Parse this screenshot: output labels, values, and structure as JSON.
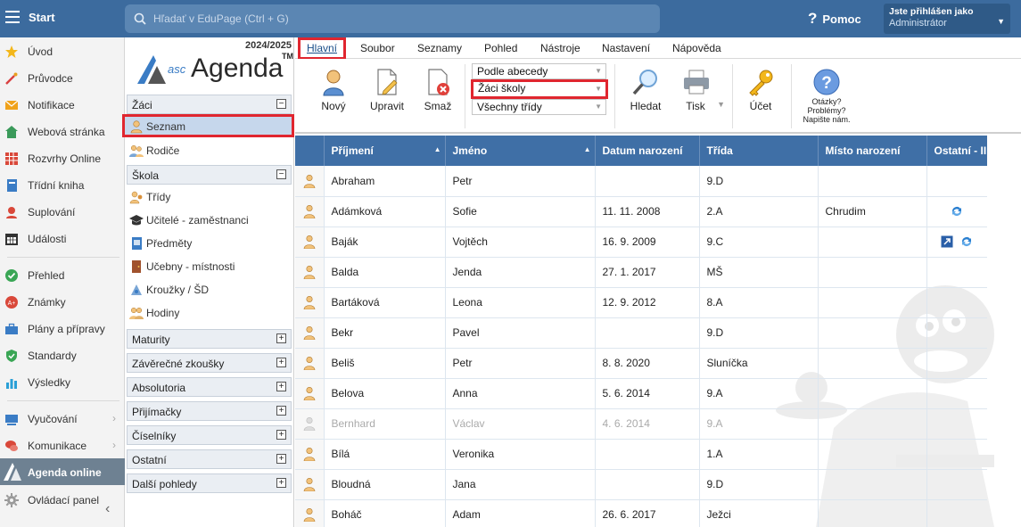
{
  "topbar": {
    "start_label": "Start",
    "search_placeholder": "Hľadať v EduPage (Ctrl + G)",
    "help_label": "Pomoc",
    "user_line1": "Jste přihlášen jako",
    "user_line2": "Administrátor"
  },
  "leftnav": {
    "items": [
      {
        "label": "Úvod",
        "icon": "star-icon"
      },
      {
        "label": "Průvodce",
        "icon": "wand-icon"
      },
      {
        "label": "Notifikace",
        "icon": "envelope-icon"
      },
      {
        "label": "Webová stránka",
        "icon": "house-icon"
      },
      {
        "label": "Rozvrhy Online",
        "icon": "timetable-icon"
      },
      {
        "label": "Třídní kniha",
        "icon": "book-icon"
      },
      {
        "label": "Suplování",
        "icon": "substitution-icon"
      },
      {
        "label": "Události",
        "icon": "calendar-icon"
      },
      {
        "label": "Přehled",
        "icon": "check-circle-icon"
      },
      {
        "label": "Známky",
        "icon": "grade-icon"
      },
      {
        "label": "Plány a přípravy",
        "icon": "briefcase-icon"
      },
      {
        "label": "Standardy",
        "icon": "shield-icon"
      },
      {
        "label": "Výsledky",
        "icon": "bar-chart-icon"
      },
      {
        "label": "Vyučování",
        "icon": "classroom-icon"
      },
      {
        "label": "Komunikace",
        "icon": "chat-icon"
      },
      {
        "label": "Agenda online",
        "icon": "agenda-icon"
      },
      {
        "label": "Ovládací panel",
        "icon": "gear-icon"
      }
    ]
  },
  "agenda": {
    "year": "2024/2025",
    "logo_prefix": "asc",
    "logo_name": "Agenda",
    "logo_tm": "TM",
    "sections": {
      "zaci": "Žáci",
      "skola": "Škola"
    },
    "zaci_items": [
      "Seznam",
      "Rodiče"
    ],
    "skola_items": [
      "Třídy",
      "Učitelé - zaměstnanci",
      "Předměty",
      "Učebny - místnosti",
      "Kroužky / ŠD",
      "Hodiny"
    ],
    "collapsed_sections": [
      "Maturity",
      "Závěrečné zkoušky",
      "Absolutoria",
      "Přijímačky",
      "Číselníky",
      "Ostatní",
      "Další pohledy"
    ]
  },
  "menubar": {
    "items": [
      "Hlavní",
      "Soubor",
      "Seznamy",
      "Pohled",
      "Nástroje",
      "Nastavení",
      "Nápověda"
    ]
  },
  "ribbon": {
    "novy": "Nový",
    "upravit": "Upravit",
    "smaz": "Smaž",
    "sort_select": "Podle abecedy",
    "type_select": "Žáci školy",
    "class_select": "Všechny třídy",
    "hledat": "Hledat",
    "tisk": "Tisk",
    "ucet": "Účet",
    "help_line1": "Otázky?",
    "help_line2": "Problémy?",
    "help_line3": "Napište nám."
  },
  "table": {
    "headers": [
      "Příjmení",
      "Jméno",
      "Datum narození",
      "Třída",
      "Místo narození",
      "Ostatní - II"
    ],
    "rows": [
      {
        "prijmeni": "Abraham",
        "jmeno": "Petr",
        "datum": "",
        "trida": "9.D",
        "misto": "",
        "extra": [],
        "dim": false
      },
      {
        "prijmeni": "Adámková",
        "jmeno": "Sofie",
        "datum": "11. 11. 2008",
        "trida": "2.A",
        "misto": "Chrudim",
        "extra": [
          "sync-icon"
        ],
        "dim": false
      },
      {
        "prijmeni": "Baják",
        "jmeno": "Vojtěch",
        "datum": "16. 9. 2009",
        "trida": "9.C",
        "misto": "",
        "extra": [
          "export-icon",
          "sync-icon"
        ],
        "dim": false
      },
      {
        "prijmeni": "Balda",
        "jmeno": "Jenda",
        "datum": "27. 1. 2017",
        "trida": "MŠ",
        "misto": "",
        "extra": [],
        "dim": false
      },
      {
        "prijmeni": "Bartáková",
        "jmeno": "Leona",
        "datum": "12. 9. 2012",
        "trida": "8.A",
        "misto": "",
        "extra": [],
        "dim": false
      },
      {
        "prijmeni": "Bekr",
        "jmeno": "Pavel",
        "datum": "",
        "trida": "9.D",
        "misto": "",
        "extra": [],
        "dim": false
      },
      {
        "prijmeni": "Beliš",
        "jmeno": "Petr",
        "datum": "8. 8. 2020",
        "trida": "Sluníčka",
        "misto": "",
        "extra": [],
        "dim": false
      },
      {
        "prijmeni": "Belova",
        "jmeno": "Anna",
        "datum": "5. 6. 2014",
        "trida": "9.A",
        "misto": "",
        "extra": [],
        "dim": false
      },
      {
        "prijmeni": "Bernhard",
        "jmeno": "Václav",
        "datum": "4. 6. 2014",
        "trida": "9.A",
        "misto": "",
        "extra": [],
        "dim": true
      },
      {
        "prijmeni": "Bílá",
        "jmeno": "Veronika",
        "datum": "",
        "trida": "1.A",
        "misto": "",
        "extra": [],
        "dim": false
      },
      {
        "prijmeni": "Bloudná",
        "jmeno": "Jana",
        "datum": "",
        "trida": "9.D",
        "misto": "",
        "extra": [],
        "dim": false
      },
      {
        "prijmeni": "Boháč",
        "jmeno": "Adam",
        "datum": "26. 6. 2017",
        "trida": "Ježci",
        "misto": "",
        "extra": [],
        "dim": false
      }
    ]
  },
  "colors": {
    "topbar": "#3c6b9e",
    "header": "#3f6fa6",
    "highlight": "#e0262f",
    "active_nav": "#6e8192"
  }
}
